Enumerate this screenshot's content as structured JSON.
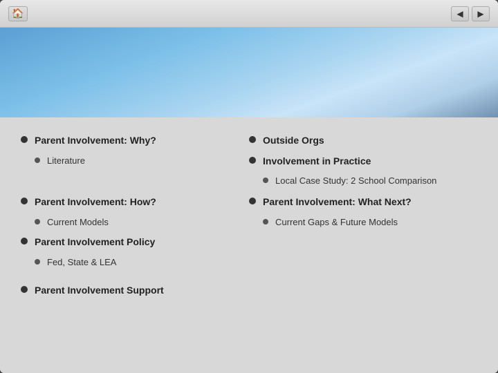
{
  "titlebar": {
    "home_icon": "🏠",
    "back_icon": "◀",
    "forward_icon": "▶"
  },
  "content": {
    "items": [
      {
        "id": "parent-involvement-why",
        "label": "Parent Involvement: Why?",
        "level": "main",
        "col": "left",
        "sub": [
          {
            "id": "literature",
            "label": "Literature"
          }
        ]
      },
      {
        "id": "outside-orgs",
        "label": "Outside Orgs",
        "level": "main",
        "col": "right",
        "sub": []
      },
      {
        "id": "involvement-in-practice",
        "label": "Involvement in Practice",
        "level": "main",
        "col": "right",
        "sub": [
          {
            "id": "local-case-study",
            "label": "Local Case Study: 2 School Comparison"
          }
        ]
      },
      {
        "id": "parent-involvement-how",
        "label": "Parent Involvement: How?",
        "level": "main",
        "col": "left",
        "sub": [
          {
            "id": "current-models",
            "label": "Current Models"
          }
        ]
      },
      {
        "id": "parent-involvement-what-next",
        "label": "Parent Involvement: What Next?",
        "level": "main",
        "col": "right",
        "sub": [
          {
            "id": "current-gaps",
            "label": "Current Gaps & Future Models"
          }
        ]
      },
      {
        "id": "parent-involvement-policy",
        "label": "Parent Involvement Policy",
        "level": "main",
        "col": "left",
        "sub": [
          {
            "id": "fed-state-lea",
            "label": "Fed, State & LEA"
          }
        ]
      },
      {
        "id": "parent-involvement-support",
        "label": "Parent Involvement Support",
        "level": "main",
        "col": "left-bottom",
        "sub": []
      }
    ]
  }
}
